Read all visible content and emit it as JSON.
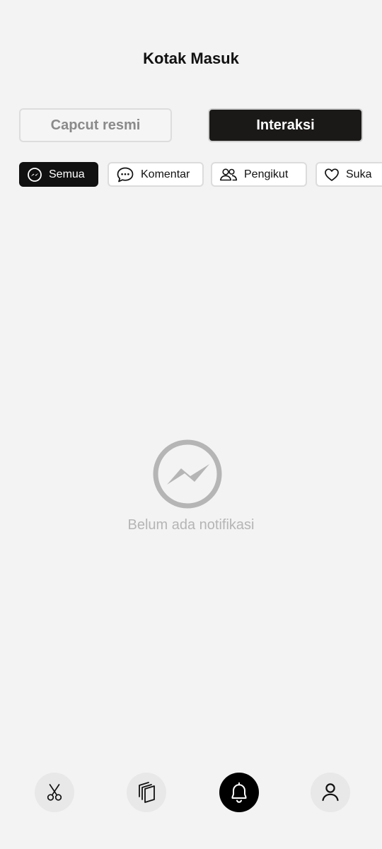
{
  "header": {
    "title": "Kotak Masuk"
  },
  "segments": {
    "official_label": "Capcut resmi",
    "interaction_label": "Interaksi",
    "active": "Interaksi"
  },
  "filters": {
    "all_label": "Semua",
    "comments_label": "Komentar",
    "followers_label": "Pengikut",
    "likes_label": "Suka",
    "active": "Semua"
  },
  "empty_state": {
    "icon": "messenger-icon",
    "message": "Belum ada notifikasi"
  },
  "bottom_nav": {
    "items": [
      {
        "icon": "scissors-icon",
        "active": false
      },
      {
        "icon": "templates-icon",
        "active": false
      },
      {
        "icon": "bell-icon",
        "active": true
      },
      {
        "icon": "profile-icon",
        "active": false
      }
    ]
  },
  "colors": {
    "background": "#f3f3f3",
    "active_fill": "#1b1918",
    "inactive_text": "#8a8a8a",
    "empty_gray": "#b5b5b5"
  }
}
